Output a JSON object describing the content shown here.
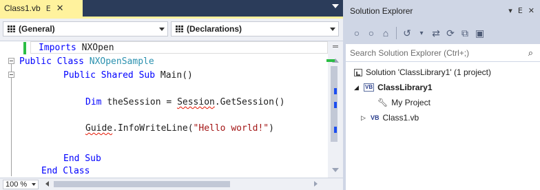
{
  "editor": {
    "tab": {
      "title": "Class1.vb",
      "pin_glyph": "ⴹ",
      "close_glyph": "✕"
    },
    "nav": {
      "left_combo": "(General)",
      "right_combo": "(Declarations)"
    },
    "code": {
      "line1": {
        "kw": "Imports ",
        "ns": "NXOpen"
      },
      "line2": {
        "fold": "⊟",
        "kw": "Public Class ",
        "type": "NXOpenSample"
      },
      "line3": {
        "kw": "Public Shared Sub ",
        "rest": "Main()"
      },
      "line4": {
        "kw": "Dim ",
        "var": "theSession = ",
        "obj": "Session",
        "rest": ".GetSession()"
      },
      "line5": {
        "obj": "Guide",
        "rest": ".InfoWriteLine(",
        "str": "\"Hello world!\"",
        "close": ")"
      },
      "line6": {
        "kw": "End Sub"
      },
      "line7": {
        "kw": "End Class"
      }
    },
    "status": {
      "zoom": "100 %"
    }
  },
  "solution_explorer": {
    "title": "Solution Explorer",
    "title_controls": {
      "dropdown": "▾",
      "pin": "ⴹ",
      "close": "✕"
    },
    "toolbar": {
      "back": "○",
      "forward": "○",
      "home": "⌂",
      "history": "↺",
      "history_dropdown": "▾",
      "sync": "⇄",
      "refresh": "⟳",
      "collapse": "⧉",
      "properties": "▣"
    },
    "search_placeholder": "Search Solution Explorer (Ctrl+;)",
    "search_icon": "⌕",
    "tree": {
      "solution": "Solution 'ClassLibrary1' (1 project)",
      "project": "ClassLibrary1",
      "project_caret": "◢",
      "project_badge": "VB",
      "my_project": "My Project",
      "class_file": "Class1.vb",
      "class_caret": "▷",
      "class_badge": "VB"
    }
  },
  "colors": {
    "active_tab": "#fff29d",
    "tab_strip": "#2b3c5a",
    "keyword": "#0000ff",
    "type": "#2b91af",
    "string": "#a31515",
    "squiggle": "#e51400",
    "change_margin": "#2bbd44",
    "chrome": "#cfd6e5"
  }
}
